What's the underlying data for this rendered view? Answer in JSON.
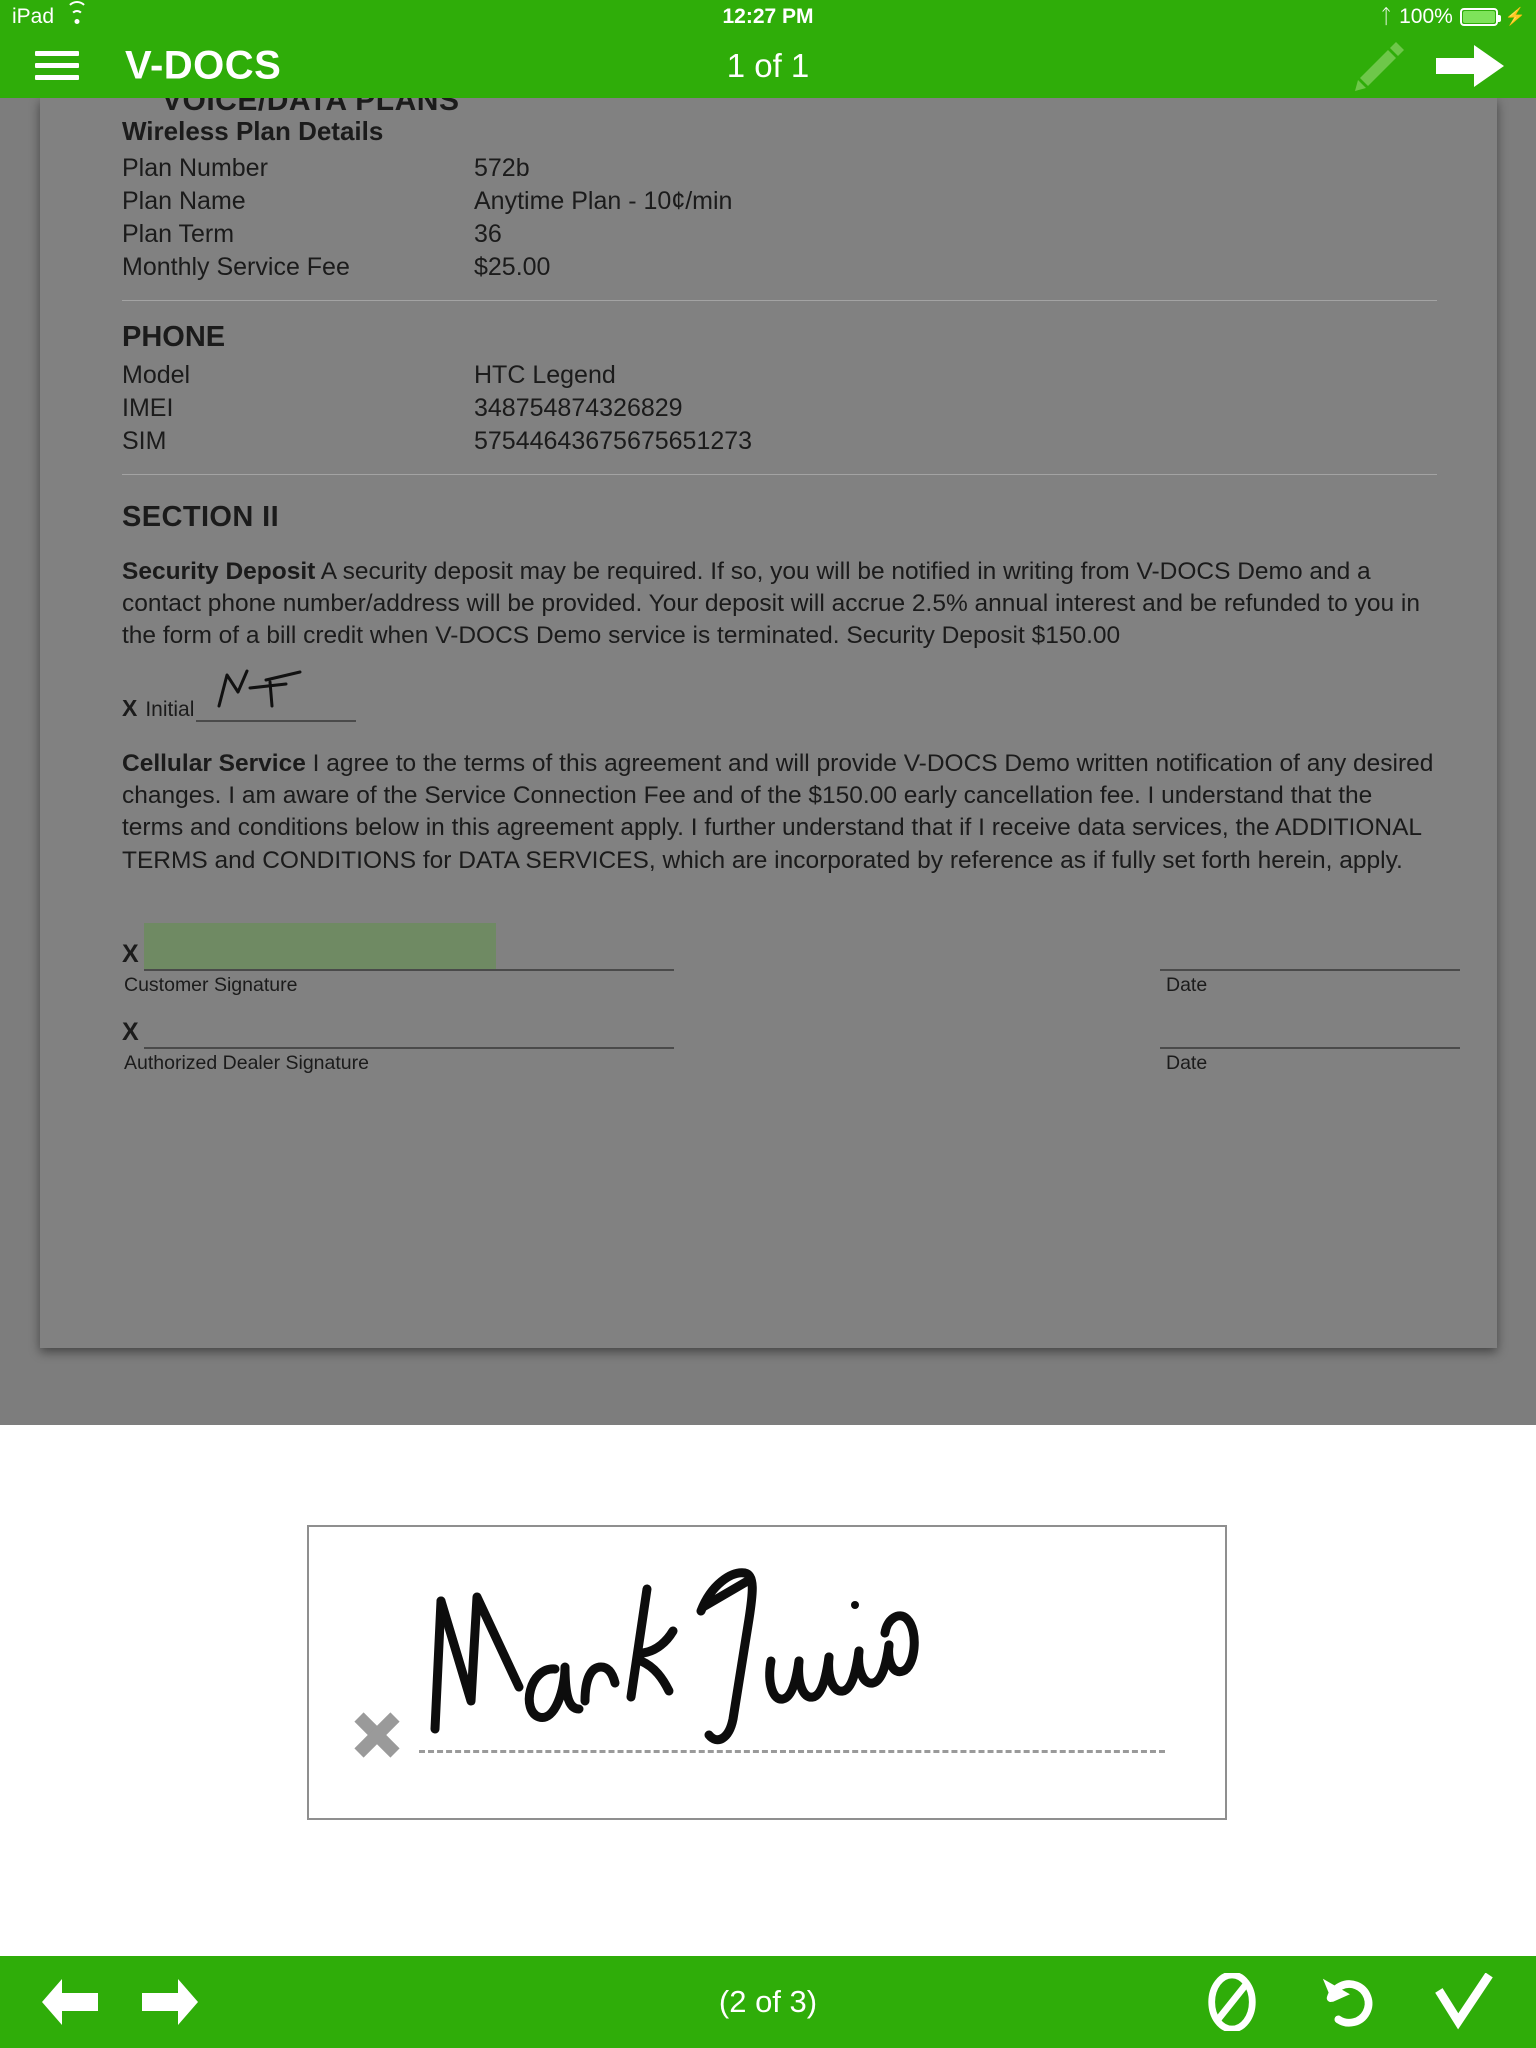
{
  "status_bar": {
    "device": "iPad",
    "wifi_icon": "wifi-icon",
    "time": "12:27 PM",
    "bluetooth_icon": "bluetooth-icon",
    "battery_percent": "100%",
    "battery_icon": "battery-full-charging-icon"
  },
  "nav_bar": {
    "menu_icon": "hamburger-menu-icon",
    "app_title": "V-DOCS",
    "page_indicator": "1 of 1",
    "edit_icon": "pencil-icon",
    "next_icon": "arrow-right-icon"
  },
  "document": {
    "clipped_heading": "VOICE/DATA PLANS",
    "wireless_plan": {
      "heading": "Wireless Plan Details",
      "rows": [
        {
          "label": "Plan Number",
          "value": "572b"
        },
        {
          "label": "Plan Name",
          "value": "Anytime Plan - 10¢/min"
        },
        {
          "label": "Plan Term",
          "value": "36"
        },
        {
          "label": "Monthly Service Fee",
          "value": "$25.00"
        }
      ]
    },
    "phone": {
      "heading": "PHONE",
      "rows": [
        {
          "label": "Model",
          "value": "HTC Legend"
        },
        {
          "label": "IMEI",
          "value": "348754874326829"
        },
        {
          "label": "SIM",
          "value": "57544643675675651273"
        }
      ]
    },
    "section_two": {
      "heading": "SECTION II",
      "security_deposit": {
        "title": "Security Deposit",
        "body": " A security deposit may be required. If so, you will be notified in writing from V-DOCS Demo and a contact phone number/address will be provided. Your deposit will accrue 2.5% annual interest and be refunded to you in the form of a bill credit when V-DOCS Demo service is terminated. Security Deposit $150.00"
      },
      "initial_field": {
        "x_mark": "X",
        "label": "Initial",
        "value": "MT"
      },
      "cellular_service": {
        "title": "Cellular Service",
        "body": " I agree to the terms of this agreement and will provide V-DOCS Demo written notification of any desired changes. I am aware of the Service Connection Fee and of the $150.00 early cancellation fee. I understand that the terms and conditions below in this agreement apply. I further understand that if I receive data services, the ADDITIONAL TERMS and CONDITIONS for DATA SERVICES, which are incorporated by reference as if fully set forth herein, apply."
      },
      "signature_rows": [
        {
          "x_mark": "X",
          "caption": "Customer Signature",
          "date_caption": "Date",
          "highlighted": true
        },
        {
          "x_mark": "X",
          "caption": "Authorized Dealer Signature",
          "date_caption": "Date",
          "highlighted": false
        }
      ]
    }
  },
  "signature_capture": {
    "clear_icon": "clear-x-icon",
    "signature_text": "Mark Twain",
    "dashed_line": "signature-baseline"
  },
  "bottom_toolbar": {
    "prev_icon": "arrow-left-icon",
    "next_icon": "arrow-right-icon",
    "field_counter": "(2 of 3)",
    "cancel_icon": "no-entry-icon",
    "undo_icon": "undo-arrow-icon",
    "accept_icon": "checkmark-icon"
  },
  "colors": {
    "brand_green": "#2fad09",
    "doc_backdrop": "#7d7d7d",
    "doc_page": "#818181",
    "highlight_field": "#6f8a63",
    "pencil_disabled": "#6ec74a"
  }
}
